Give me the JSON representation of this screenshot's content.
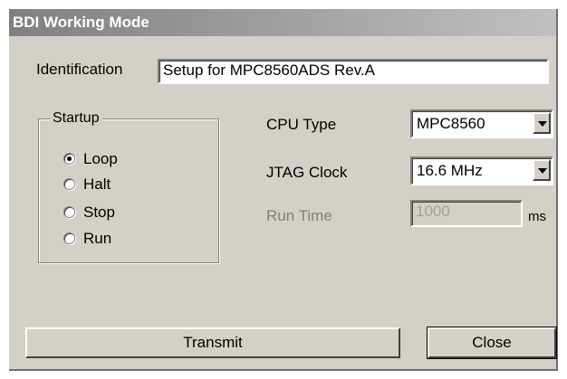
{
  "window": {
    "title": "BDI Working Mode"
  },
  "identification": {
    "label": "Identification",
    "value": "Setup for MPC8560ADS Rev.A"
  },
  "startup": {
    "title": "Startup",
    "selected": "Loop",
    "options": [
      {
        "label": "Loop"
      },
      {
        "label": "Halt"
      },
      {
        "label": "Stop"
      },
      {
        "label": "Run"
      }
    ]
  },
  "cpu_type": {
    "label": "CPU Type",
    "value": "MPC8560",
    "icon": "chevron-down-icon"
  },
  "jtag_clock": {
    "label": "JTAG Clock",
    "value": "16.6 MHz",
    "icon": "chevron-down-icon"
  },
  "run_time": {
    "label": "Run Time",
    "value": "1000",
    "unit": "ms",
    "enabled": false
  },
  "buttons": {
    "transmit": "Transmit",
    "close": "Close"
  }
}
